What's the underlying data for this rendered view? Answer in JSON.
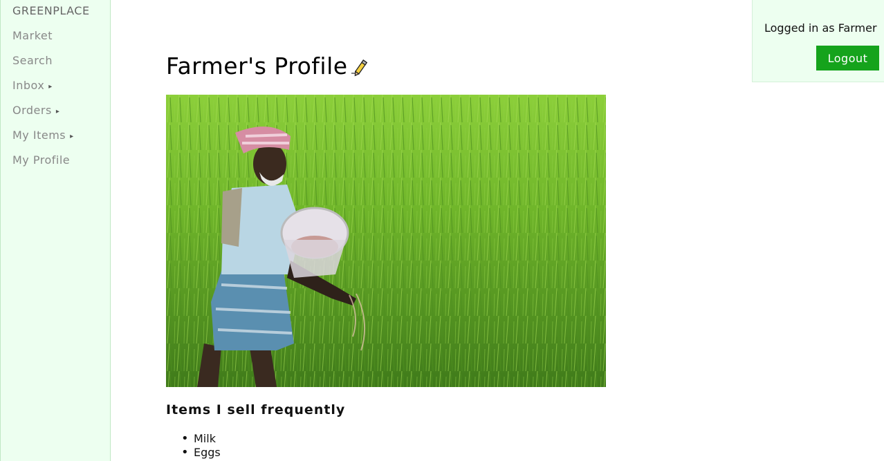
{
  "sidebar": {
    "brand": "GREENPLACE",
    "items": [
      {
        "label": "Market",
        "has_arrow": false
      },
      {
        "label": "Search",
        "has_arrow": false
      },
      {
        "label": "Inbox",
        "has_arrow": true
      },
      {
        "label": "Orders",
        "has_arrow": true
      },
      {
        "label": "My Items",
        "has_arrow": true
      },
      {
        "label": "My Profile",
        "has_arrow": false
      }
    ],
    "arrow_glyph": "▸"
  },
  "user": {
    "status": "Logged in as Farmer",
    "logout_label": "Logout"
  },
  "profile": {
    "title": "Farmer's Profile",
    "edit_icon": "pencil-icon",
    "photo": "farmer-in-rice-field",
    "items_heading": "Items I sell frequently",
    "items": [
      "Milk",
      "Eggs"
    ]
  },
  "colors": {
    "sidebar_bg": "#edfff0",
    "accent": "#15a31c"
  }
}
